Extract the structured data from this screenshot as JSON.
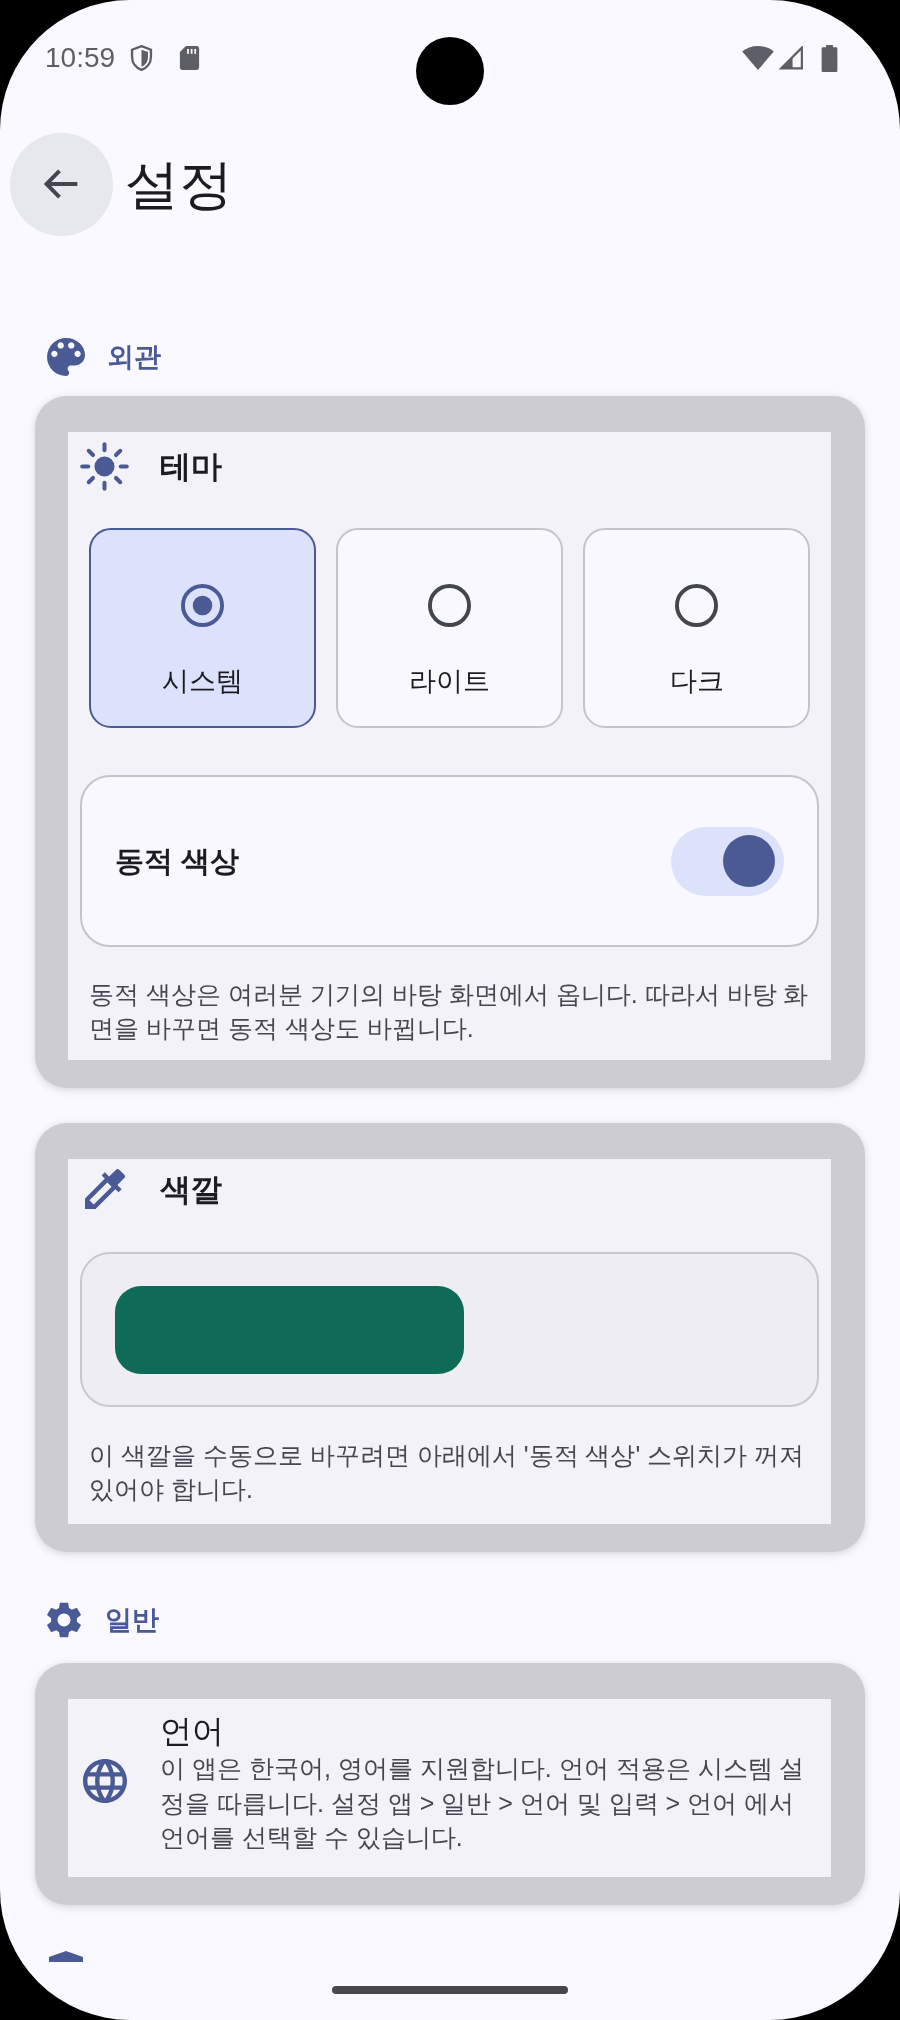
{
  "status_bar": {
    "time": "10:59"
  },
  "app_bar": {
    "title": "설정"
  },
  "appearance_section": {
    "header": "외관",
    "theme_card": {
      "title": "테마",
      "options": [
        {
          "label": "시스템",
          "selected": true
        },
        {
          "label": "라이트",
          "selected": false
        },
        {
          "label": "다크",
          "selected": false
        }
      ],
      "dynamic_color": {
        "label": "동적 색상",
        "on": true
      },
      "description": "동적 색상은 여러분 기기의 바탕 화면에서 옵니다. 따라서 바탕 화면을 바꾸면 동적 색상도 바뀝니다."
    },
    "color_card": {
      "title": "색깔",
      "swatch": {
        "color": "#106a58"
      },
      "description": "이 색깔을 수동으로 바꾸려면 아래에서 '동적 색상' 스위치가 꺼져 있어야 합니다."
    }
  },
  "general_section": {
    "header": "일반",
    "language_card": {
      "title": "언어",
      "description": "이 앱은 한국어, 영어를 지원합니다. 언어 적용은 시스템 설정을 따릅니다. 설정 앱 > 일반 > 언어 및 입력 > 언어 에서 언어를 선택할 수 있습니다."
    }
  }
}
